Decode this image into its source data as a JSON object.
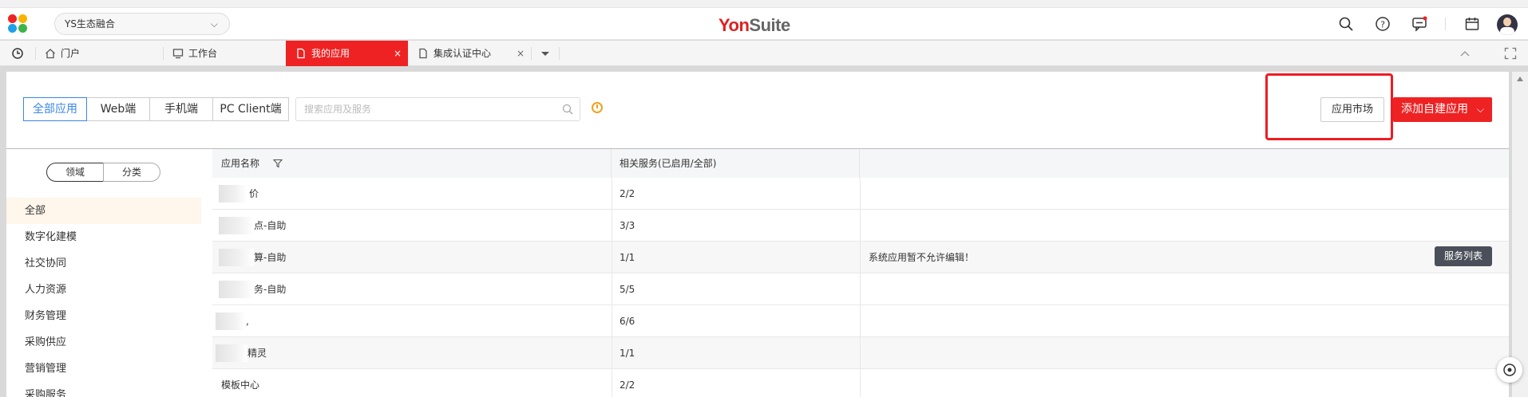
{
  "header": {
    "tenant_label": "YS生态融合",
    "brand_yon": "Yon",
    "brand_suite": "Suite",
    "icons": [
      "search-icon",
      "help-icon",
      "message-icon",
      "calendar-icon",
      "avatar"
    ],
    "accent_color": "#ee2223"
  },
  "tabs": [
    {
      "label": "门户",
      "icon": "home-icon",
      "active": false
    },
    {
      "label": "工作台",
      "icon": "monitor-icon",
      "active": false
    },
    {
      "label": "我的应用",
      "icon": "document-icon",
      "active": true,
      "close": "×"
    },
    {
      "label": "集成认证中心",
      "icon": "document-icon",
      "active": false,
      "close": "×"
    }
  ],
  "filters": {
    "segments": [
      "全部应用",
      "Web端",
      "手机端",
      "PC Client端"
    ],
    "active_segment": "全部应用",
    "search_placeholder": "搜索应用及服务"
  },
  "actions": {
    "market_label": "应用市场",
    "add_label": "添加自建应用"
  },
  "sidebar": {
    "toggle": [
      "领域",
      "分类"
    ],
    "categories": [
      "全部",
      "数字化建模",
      "社交协同",
      "人力资源",
      "财务管理",
      "采购供应",
      "营销管理",
      "采购服务"
    ]
  },
  "table": {
    "columns": [
      "应用名称",
      "相关服务(已启用/全部)"
    ],
    "rows": [
      {
        "name": "价",
        "services": "2/2",
        "note": ""
      },
      {
        "name": "点-自助",
        "services": "3/3",
        "note": ""
      },
      {
        "name": "算-自助",
        "services": "1/1",
        "note": "系统应用暂不允许编辑！",
        "button": "服务列表"
      },
      {
        "name": "务-自助",
        "services": "5/5",
        "note": ""
      },
      {
        "name": ",",
        "services": "6/6",
        "note": ""
      },
      {
        "name": "精灵",
        "services": "1/1",
        "note": ""
      },
      {
        "name": "模板中心",
        "services": "2/2",
        "note": ""
      }
    ]
  }
}
